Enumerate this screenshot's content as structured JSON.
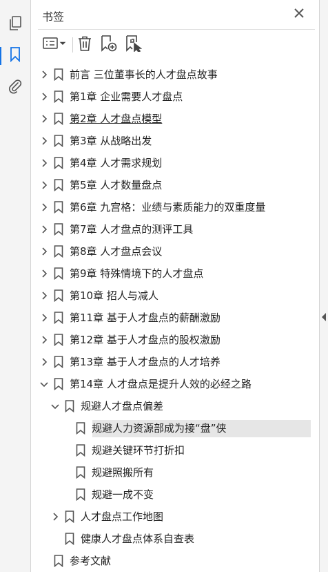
{
  "panel": {
    "title": "书签"
  },
  "bookmarks": [
    {
      "label": "前言 三位董事长的人才盘点故事",
      "expander": "chevron-right-icon"
    },
    {
      "label": "第1章 企业需要人才盘点",
      "expander": "chevron-right-icon"
    },
    {
      "label": "第2章 人才盘点模型",
      "expander": "chevron-right-icon"
    },
    {
      "label": "第3章 从战略出发",
      "expander": "chevron-right-icon"
    },
    {
      "label": "第4章 人才需求规划",
      "expander": "chevron-right-icon"
    },
    {
      "label": "第5章 人才数量盘点",
      "expander": "chevron-right-icon"
    },
    {
      "label": "第6章 九宫格：业绩与素质能力的双重度量",
      "expander": "chevron-right-icon"
    },
    {
      "label": "第7章 人才盘点的测评工具",
      "expander": "chevron-right-icon"
    },
    {
      "label": "第8章 人才盘点会议",
      "expander": "chevron-right-icon"
    },
    {
      "label": "第9章 特殊情境下的人才盘点",
      "expander": "chevron-right-icon"
    },
    {
      "label": "第10章 招人与减人",
      "expander": "chevron-right-icon"
    },
    {
      "label": "第11章 基于人才盘点的薪酬激励",
      "expander": "chevron-right-icon"
    },
    {
      "label": "第12章 基于人才盘点的股权激励",
      "expander": "chevron-right-icon"
    },
    {
      "label": "第13章 基于人才盘点的人才培养",
      "expander": "chevron-right-icon"
    },
    {
      "label": "第14章 人才盘点是提升人效的必经之路",
      "expander": "chevron-down-icon"
    },
    {
      "label": "规避人才盘点偏差",
      "expander": "chevron-down-icon"
    },
    {
      "label": "规避人力资源部成为接“盘”侠",
      "expander": ""
    },
    {
      "label": "规避关键环节打折扣",
      "expander": ""
    },
    {
      "label": "规避照搬所有",
      "expander": ""
    },
    {
      "label": "规避一成不变",
      "expander": ""
    },
    {
      "label": "人才盘点工作地图",
      "expander": "chevron-right-icon"
    },
    {
      "label": "健康人才盘点体系自查表",
      "expander": ""
    },
    {
      "label": "参考文献",
      "expander": ""
    }
  ]
}
